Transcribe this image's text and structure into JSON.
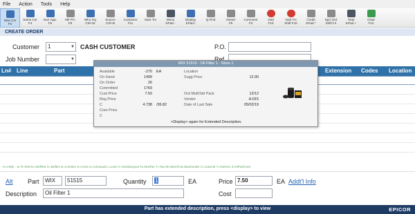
{
  "menu": [
    "File",
    "Action",
    "Tools",
    "Help"
  ],
  "toolbar": [
    {
      "l1": "New Csr",
      "l2": "F2",
      "icon": "new-customer-icon",
      "color": "blue",
      "selected": true
    },
    {
      "l1": "Same Csr",
      "l2": "F4",
      "icon": "same-customer-icon",
      "color": "blue"
    },
    {
      "l1": "Non-App.",
      "l2": "F6",
      "icon": "non-app-icon",
      "color": "blue"
    },
    {
      "l1": "Mfr Prc",
      "l2": "F8",
      "icon": "manufacturer-price-icon",
      "color": "gray"
    },
    {
      "l1": "Who Inq",
      "l2": "Ctrl+W",
      "icon": "who-inquiry-icon",
      "color": "blue"
    },
    {
      "l1": "Source",
      "l2": "Ctrl+B",
      "icon": "source-icon",
      "color": "gray"
    },
    {
      "l1": "Customer",
      "l2": "F11",
      "icon": "customer-icon",
      "color": "blue"
    },
    {
      "l1": "Start Trx",
      "l2": "",
      "icon": "start-transaction-icon",
      "color": "gray"
    },
    {
      "l1": "Menu",
      "l2": "KPad -",
      "icon": "menu-icon",
      "color": "dk"
    },
    {
      "l1": "Display",
      "l2": "KPad /",
      "icon": "display-icon",
      "color": "blue"
    },
    {
      "l1": "Q.Find",
      "l2": "",
      "icon": "quick-find-icon",
      "color": "gray"
    },
    {
      "l1": "Viewer",
      "l2": "F9",
      "icon": "viewer-icon",
      "color": "gray"
    },
    {
      "l1": "Comment",
      "l2": "F3",
      "icon": "comment-icon",
      "color": "gray"
    },
    {
      "l1": "Void",
      "l2": "F10",
      "icon": "void-icon",
      "color": "red"
    },
    {
      "l1": "Void Trx",
      "l2": "Shift F10",
      "icon": "void-transaction-icon",
      "color": "red"
    },
    {
      "l1": "Credit",
      "l2": "KPad *",
      "icon": "credit-icon",
      "color": "gray"
    },
    {
      "l1": "Spcl Ord",
      "l2": "Shift F4",
      "icon": "special-order-icon",
      "color": "gray"
    },
    {
      "l1": "Total",
      "l2": "KPad +",
      "icon": "total-icon",
      "color": "dk"
    },
    {
      "l1": "Clear",
      "l2": "F12",
      "icon": "clear-icon",
      "color": "green"
    }
  ],
  "section_title": "CREATE ORDER",
  "header": {
    "customer_label": "Customer",
    "customer_value": "1",
    "customer_name": "CASH CUSTOMER",
    "job_label": "Job Number",
    "job_value": "",
    "po_label": "P.O.",
    "po_value": "",
    "ref_label": "Ref",
    "ref_value": ""
  },
  "grid_columns": {
    "ln": "Ln#",
    "line": "Line",
    "part": "Part",
    "extension": "Extension",
    "codes": "Codes",
    "location": "Location"
  },
  "popup": {
    "title": "WIX 51515 - Oil Filter 1 - Store 1",
    "available_label": "Available",
    "available_value": "-270",
    "available_unit": "EA",
    "onhand_label": "On Hand",
    "onhand_value": "1499",
    "onorder_label": "On Order",
    "onorder_value": "26",
    "committed_label": "Committed",
    "committed_value": "1769",
    "custprice_label": "Cust Price",
    "custprice_value": "7.50",
    "regprice_label": "Reg Price",
    "regprice_value": "",
    "c1_label": "C",
    "c1_value": "4.738",
    "c1_value2": "/36.82",
    "coreprice_label": "Core Price",
    "coreprice_value": "",
    "c2_label": "C",
    "c2_value": "",
    "location_label": "Location",
    "location_value": "",
    "suggprice_label": "Sugg Price",
    "suggprice_value": "12.90",
    "ordmult_label": "Ord Mult/Std Pack",
    "ordmult_value": "12/12",
    "vendor_label": "Vendor",
    "vendor_value": "A-DIS",
    "lastsale_label": "Date of Last Sale",
    "lastsale_value": "05/02/19",
    "footer": "<Display> again for Extended Description."
  },
  "hotkeys": "H=Help - or R=Ret D=DefRet X=DefEx E=CoreEx X=Core U=Unusual L=Lost V=VendJoyout N=NotTax T=Tax M=Merch B=Backorder C=Cancel T=NonOc Z=NPw/Core",
  "entry": {
    "alt_link": "Alt",
    "part_label": "Part",
    "part_mfr": "WIX",
    "part_number": "51515",
    "quantity_label": "Quantity",
    "quantity_value": "1",
    "quantity_unit": "EA",
    "price_label": "Price",
    "price_value": "7.50",
    "price_unit": "EA",
    "addtl_info_link": "Addt'l Info",
    "description_label": "Description",
    "description_value": "Oil Filter 1",
    "cost_label": "Cost",
    "cost_value": ""
  },
  "status": {
    "message": "Part has extended description, press <display> to view",
    "brand": "EPICOR"
  }
}
